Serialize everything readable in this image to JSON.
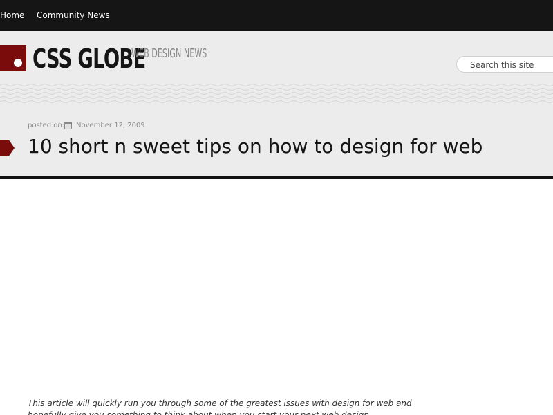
{
  "nav": {
    "items": [
      {
        "label": "Home"
      },
      {
        "label": "Community News"
      }
    ]
  },
  "header": {
    "logo_text": "CSS GLOBE",
    "tagline": "WEB DESIGN NEWS",
    "search_placeholder": "Search this site"
  },
  "post": {
    "posted_label": "posted on:",
    "date": "November 12, 2009",
    "title": "10 short n sweet tips on how to design for web",
    "intro": "This article will quickly run you through some of the greatest issues with design for web and hopefully give you something to think about when you start your next web design."
  },
  "colors": {
    "accent": "#7a0c0c",
    "nav_bg": "#151515",
    "header_bg": "#ececec"
  }
}
